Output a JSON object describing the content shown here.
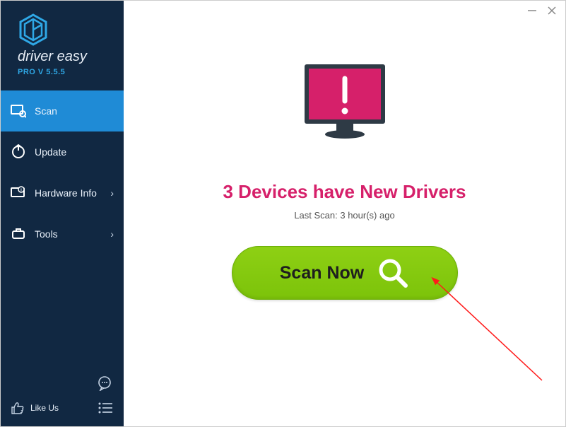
{
  "brand": {
    "name": "driver easy",
    "version": "PRO V 5.5.5"
  },
  "sidebar": {
    "items": [
      {
        "label": "Scan"
      },
      {
        "label": "Update"
      },
      {
        "label": "Hardware Info"
      },
      {
        "label": "Tools"
      }
    ],
    "likeus": "Like Us"
  },
  "main": {
    "headline": "3 Devices have New Drivers",
    "lastscan": "Last Scan: 3 hour(s) ago",
    "scan_label": "Scan Now"
  }
}
